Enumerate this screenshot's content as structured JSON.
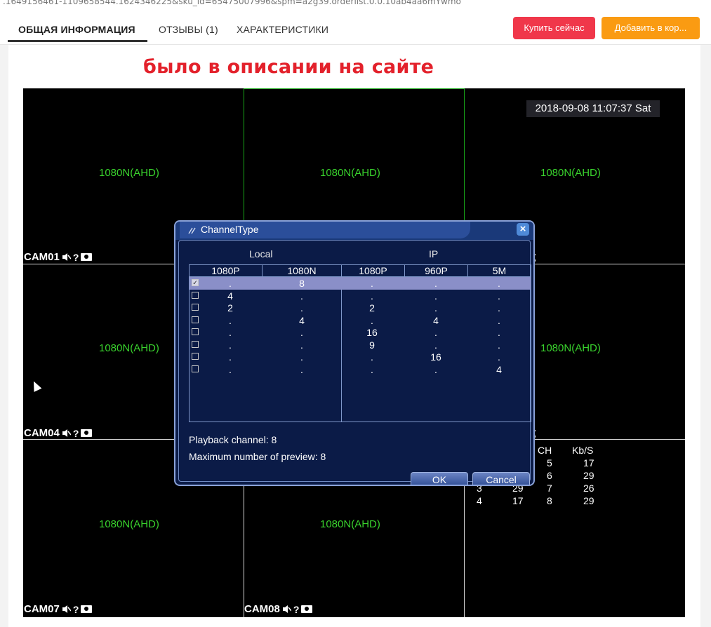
{
  "browser": {
    "url": ".1649156461-1109658544.1624346225&sku_id=65475007996&spm=a2g39.orderlist.0.0.10ab4aa6mYwmo"
  },
  "tabs": [
    {
      "label": "ОБЩАЯ ИНФОРМАЦИЯ",
      "active": true
    },
    {
      "label": "ОТЗЫВЫ (1)",
      "active": false
    },
    {
      "label": "ХАРАКТЕРИСТИКИ",
      "active": false
    }
  ],
  "buttons": {
    "buy_now": "Купить сейчас",
    "add_to_cart": "Добавить в кор..."
  },
  "colors": {
    "buy": "#f0374a",
    "cart": "#fa9b12",
    "heading": "#e3212b",
    "resolution_text": "#39d22d"
  },
  "heading": "было в описании на сайте",
  "dvr": {
    "datetime": "2018-09-08 11:07:37 Sat",
    "resolution": "1080N(AHD)",
    "cameras": [
      {
        "name": "CAM01"
      },
      {
        "name": "CAM04"
      },
      {
        "name": "CAM07"
      },
      {
        "name": "CAM08"
      }
    ],
    "stats": {
      "headers": [
        "CH",
        "Kb/S"
      ],
      "rows": [
        [
          "",
          "",
          "5",
          "17"
        ],
        [
          "",
          "",
          "6",
          "29"
        ],
        [
          "3",
          "29",
          "7",
          "26"
        ],
        [
          "4",
          "17",
          "8",
          "29"
        ]
      ]
    }
  },
  "dialog": {
    "title": "ChannelType",
    "group_local": "Local",
    "group_ip": "IP",
    "columns": [
      "1080P",
      "1080N",
      "1080P",
      "960P",
      "5M"
    ],
    "rows": [
      {
        "checked": true,
        "cells": [
          ".",
          "8",
          ".",
          ".",
          "."
        ]
      },
      {
        "checked": false,
        "cells": [
          "4",
          ".",
          ".",
          ".",
          "."
        ]
      },
      {
        "checked": false,
        "cells": [
          "2",
          ".",
          "2",
          ".",
          "."
        ]
      },
      {
        "checked": false,
        "cells": [
          ".",
          "4",
          ".",
          "4",
          "."
        ]
      },
      {
        "checked": false,
        "cells": [
          ".",
          ".",
          "16",
          ".",
          "."
        ]
      },
      {
        "checked": false,
        "cells": [
          ".",
          ".",
          "9",
          ".",
          "."
        ]
      },
      {
        "checked": false,
        "cells": [
          ".",
          ".",
          ".",
          "16",
          "."
        ]
      },
      {
        "checked": false,
        "cells": [
          ".",
          ".",
          ".",
          ".",
          "4"
        ]
      }
    ],
    "playback_channel": "Playback channel: 8",
    "max_preview": "Maximum number of preview: 8",
    "ok_label": "OK",
    "cancel_label": "Cancel"
  }
}
